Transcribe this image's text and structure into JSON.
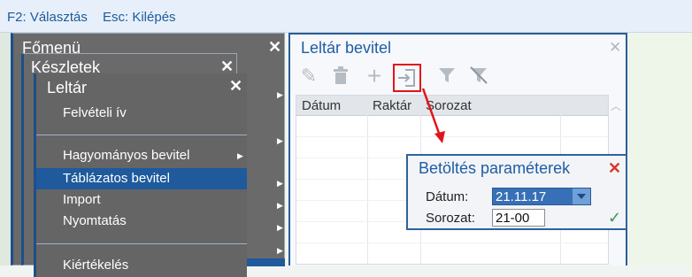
{
  "topbar": {
    "hint_f2": "F2: Választás",
    "hint_esc": "Esc: Kilépés"
  },
  "menus": {
    "fomenu_title": "Főmenü",
    "keszletek_title": "Készletek",
    "leltar_title": "Leltár",
    "items": [
      {
        "label": "Felvételi ív",
        "submenu": false
      },
      {
        "label": "Hagyományos bevitel",
        "submenu": true
      },
      {
        "label": "Táblázatos bevitel",
        "submenu": true,
        "selected": true
      },
      {
        "label": "Import",
        "submenu": true
      },
      {
        "label": "Nyomtatás",
        "submenu": true
      },
      {
        "label": "Kiértékelés",
        "submenu": false
      }
    ]
  },
  "panel": {
    "title": "Leltár bevitel",
    "columns": [
      "Dátum",
      "Raktár",
      "Sorozat"
    ],
    "toolbar_icons": [
      "pencil-icon",
      "trash-icon",
      "plus-icon",
      "import-icon",
      "filter-icon",
      "clear-filter-icon"
    ]
  },
  "dialog": {
    "title": "Betöltés paraméterek",
    "date_label": "Dátum:",
    "date_value": "21.11.17",
    "series_label": "Sorozat:",
    "series_value": "21-00"
  },
  "colors": {
    "accent": "#1e5a9c",
    "highlight": "#e0151b",
    "confirm": "#3a9a5a"
  }
}
